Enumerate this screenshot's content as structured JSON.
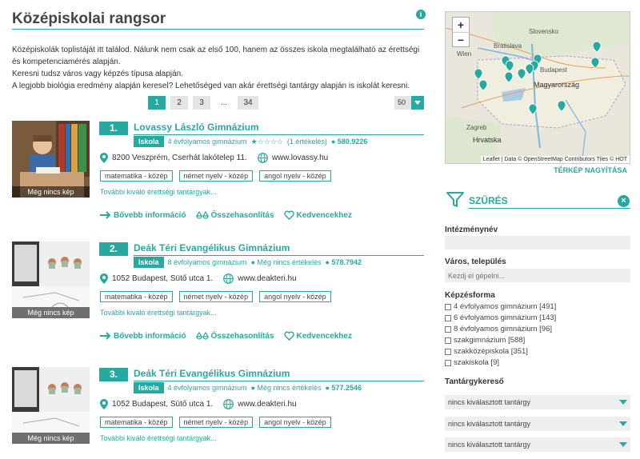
{
  "page": {
    "title": "Középiskolai rangsor",
    "intro": [
      "Középiskolák toplistáját itt találod. Nálunk nem csak az első 100, hanem az összes iskola megtalálható az érettségi és kompetenciamérés alapján.",
      "Keresni tudsz város vagy képzés típusa alapján.",
      "A legjobb biológia eredmény alapján keresel? Lehetőséged van akár érettségi tantárgy alapján is iskolát keresni."
    ]
  },
  "pager": {
    "pages": [
      "1",
      "2",
      "3",
      "...",
      "34"
    ],
    "active": "1",
    "per_page": "50"
  },
  "schools": [
    {
      "rank": "1.",
      "name": "Lovassy László Gimnázium",
      "badge": "Iskola",
      "type": "4 évfolyamos gimnázium",
      "stars": "★☆☆☆☆",
      "rating_text": "(1 értékelés)",
      "score": "● 580.9226",
      "address": "8200 Veszprém, Cserhát lakótelep 11.",
      "website": "www.lovassy.hu",
      "tags": [
        "matematika - közép",
        "német nyelv - közép",
        "angol nyelv - közép"
      ],
      "more": "További kiváló érettségi tantárgyak...",
      "thumb_caption": "Még nincs kép",
      "actions": [
        "Bővebb információ",
        "Összehasonlítás",
        "Kedvencekhez"
      ]
    },
    {
      "rank": "2.",
      "name": "Deák Téri Evangélikus Gimnázium",
      "badge": "Iskola",
      "type": "8 évfolyamos gimnázium",
      "stars": "",
      "rating_text": "● Még nincs értékelés",
      "score": "● 578.7942",
      "address": "1052 Budapest, Sütő utca 1.",
      "website": "www.deakteri.hu",
      "tags": [
        "matematika - közép",
        "német nyelv - közép",
        "angol nyelv - közép"
      ],
      "more": "További kiváló érettségi tantárgyak...",
      "thumb_caption": "Még nincs kép",
      "actions": [
        "Bővebb információ",
        "Összehasonlítás",
        "Kedvencekhez"
      ]
    },
    {
      "rank": "3.",
      "name": "Deák Téri Evangélikus Gimnázium",
      "badge": "Iskola",
      "type": "4 évfolyamos gimnázium",
      "stars": "",
      "rating_text": "● Még nincs értékelés",
      "score": "● 577.2546",
      "address": "1052 Budapest, Sütő utca 1.",
      "website": "www.deakteri.hu",
      "tags": [
        "matematika - közép",
        "német nyelv - közép",
        "angol nyelv - közép"
      ],
      "more": "További kiváló érettségi tantárgyak...",
      "thumb_caption": "Még nincs kép"
    }
  ],
  "map": {
    "zoom_in": "+",
    "zoom_out": "−",
    "labels": [
      "Slovensko",
      "Bratislava",
      "Wien",
      "Budapest",
      "Magyarország",
      "Zagreb",
      "Hrvatska"
    ],
    "attribution": "Leaflet | Data © OpenStreetMap Contributors Tiles © HOT",
    "expand": "TÉRKÉP NAGYÍTÁSA"
  },
  "filter": {
    "title": "SZŰRÉS",
    "close": "×",
    "institution_label": "Intézménynév",
    "institution_value": "",
    "city_label": "Város, település",
    "city_placeholder": "Kezdj el gépelni...",
    "training_label": "Képzésforma",
    "training_options": [
      "4 évfolyamos gimnázium [491]",
      "6 évfolyamos gimnázium [143]",
      "8 évfolyamos gimnázium [96]",
      "szakgimnázium [588]",
      "szakközépiskola [351]",
      "szakiskola [9]"
    ],
    "subject_label": "Tantárgykereső",
    "subject_selects": [
      "nincs kiválasztott tantárgy",
      "nincs kiválasztott tantárgy",
      "nincs kiválasztott tantárgy"
    ]
  },
  "colors": {
    "accent": "#27a9a1",
    "icon": "info-icon"
  }
}
